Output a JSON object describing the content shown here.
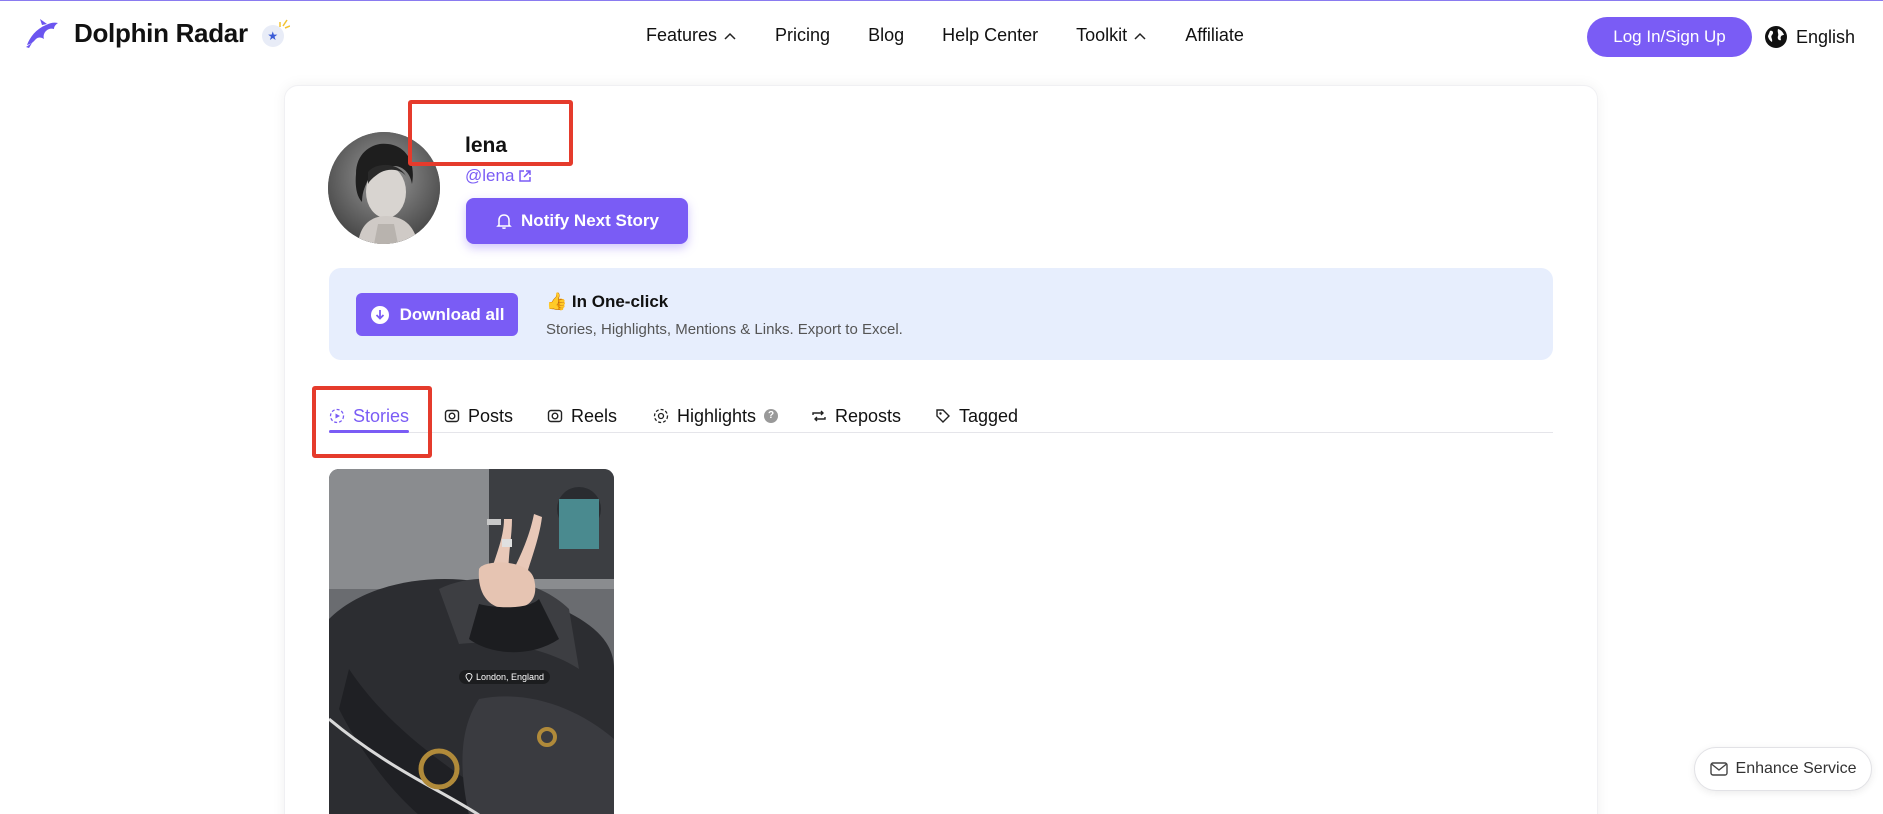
{
  "brand": {
    "name": "Dolphin Radar",
    "badge_icon": "star-badge-icon"
  },
  "nav": {
    "items": [
      {
        "label": "Features",
        "has_chevron": true
      },
      {
        "label": "Pricing",
        "has_chevron": false
      },
      {
        "label": "Blog",
        "has_chevron": false
      },
      {
        "label": "Help Center",
        "has_chevron": false
      },
      {
        "label": "Toolkit",
        "has_chevron": true
      },
      {
        "label": "Affiliate",
        "has_chevron": false
      }
    ],
    "login_label": "Log In/Sign Up",
    "language": "English"
  },
  "profile": {
    "name": "lena",
    "handle": "@lena",
    "notify_label": "Notify Next Story"
  },
  "promo": {
    "button_label": "Download all",
    "title": "👍 In One-click",
    "subtitle": "Stories, Highlights, Mentions & Links. Export to Excel."
  },
  "tabs": [
    {
      "label": "Stories",
      "icon": "stories-icon",
      "active": true
    },
    {
      "label": "Posts",
      "icon": "camera-icon",
      "active": false
    },
    {
      "label": "Reels",
      "icon": "camera-icon",
      "active": false
    },
    {
      "label": "Highlights",
      "icon": "highlights-icon",
      "active": false,
      "help": "?"
    },
    {
      "label": "Reposts",
      "icon": "repost-icon",
      "active": false
    },
    {
      "label": "Tagged",
      "icon": "tag-icon",
      "active": false
    }
  ],
  "story": {
    "location": "London, England"
  },
  "support": {
    "label": "Enhance Service"
  },
  "colors": {
    "accent": "#7a5cf5",
    "promo_bg": "#e7eefd",
    "annotation": "#e53b2c"
  }
}
